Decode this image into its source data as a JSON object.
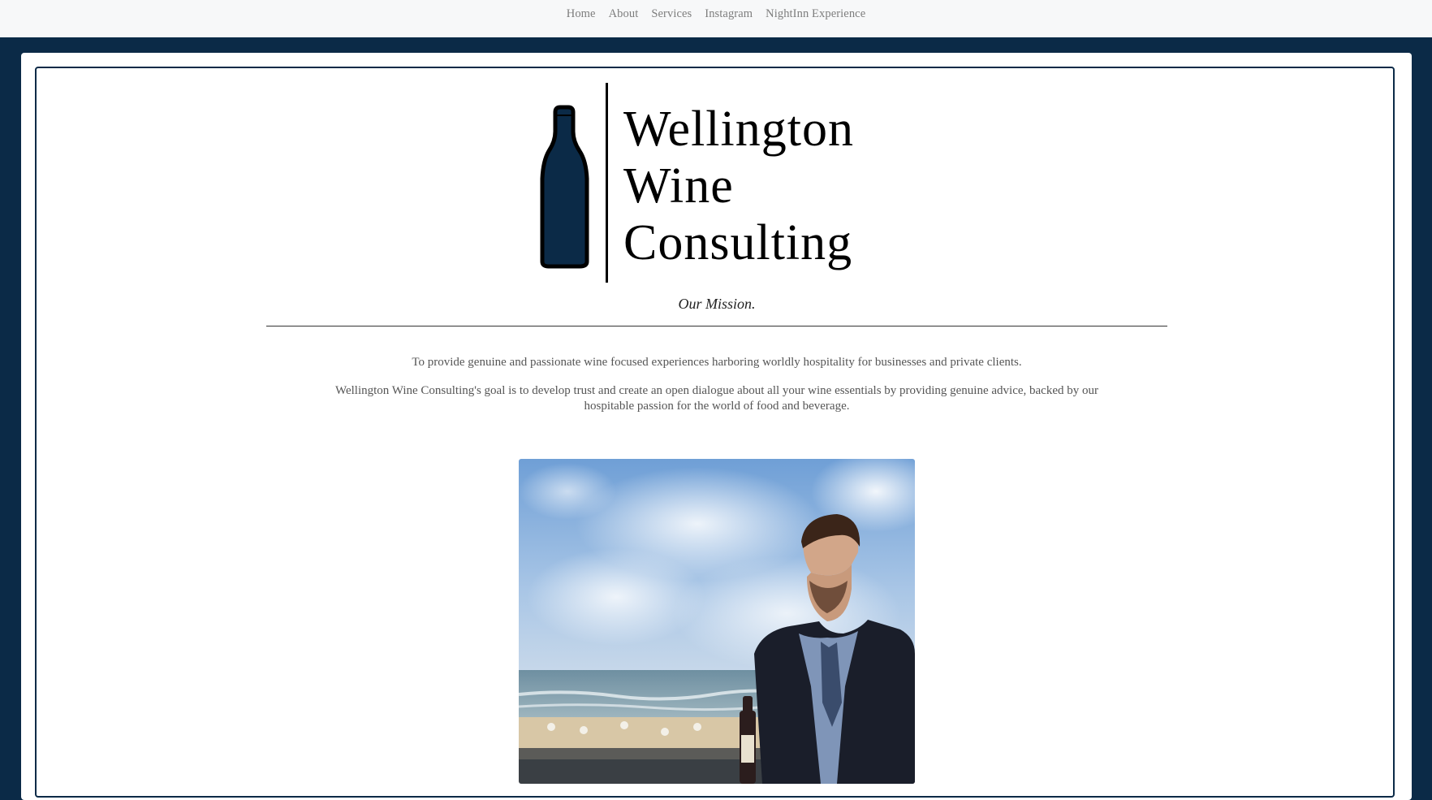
{
  "nav": {
    "items": [
      {
        "label": "Home"
      },
      {
        "label": "About"
      },
      {
        "label": "Services"
      },
      {
        "label": "Instagram"
      },
      {
        "label": "NightInn Experience"
      }
    ]
  },
  "logo": {
    "line1": "Wellington",
    "line2": "Wine",
    "line3": "Consulting",
    "icon": "wine-bottle-icon"
  },
  "mission": {
    "title": "Our Mission.",
    "paragraph1": "To provide genuine and passionate wine focused experiences harboring worldly hospitality for businesses and private clients.",
    "paragraph2": "Wellington Wine Consulting's goal is to develop trust and create an open dialogue about all your wine essentials by providing genuine advice, backed by our hospitable passion for the world of food and beverage."
  },
  "colors": {
    "page_background": "#0b2a47",
    "nav_background": "#f7f8f9",
    "nav_text": "#7d7d7d",
    "card_border": "#0b2a47",
    "body_text": "#555555"
  }
}
